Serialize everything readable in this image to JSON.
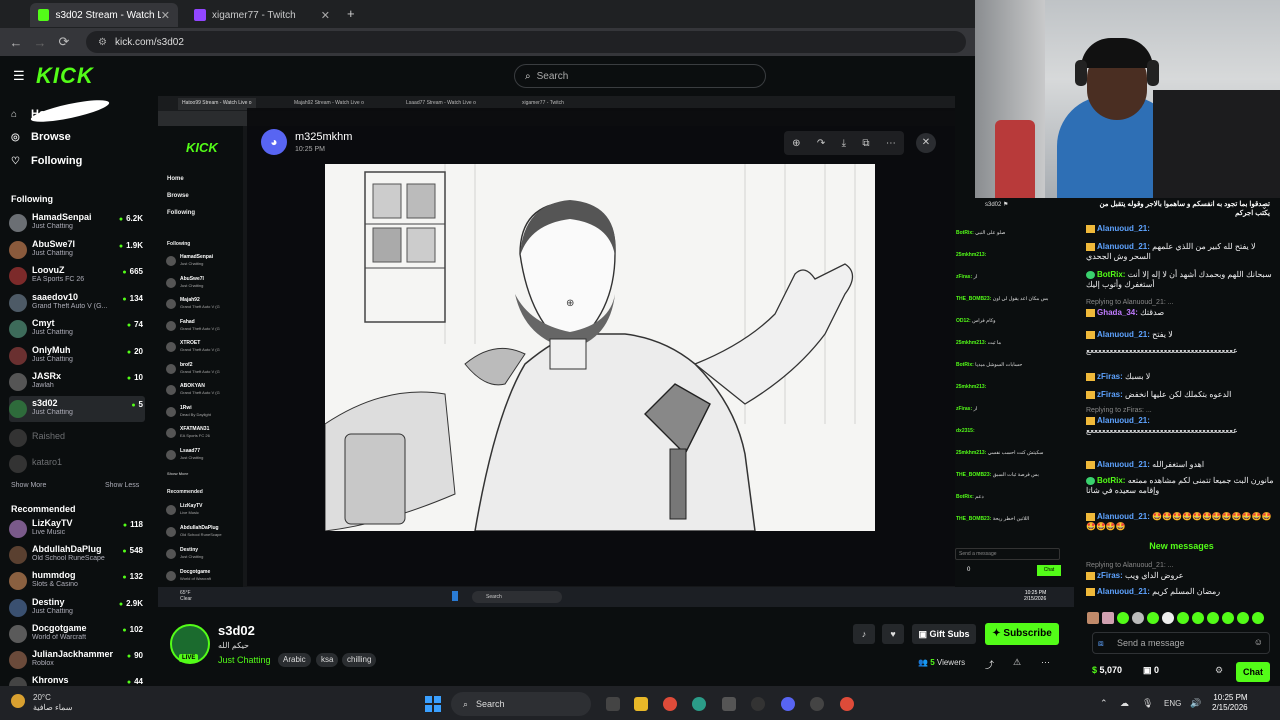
{
  "browser": {
    "tabs": [
      {
        "title": "s3d02 Stream - Watch Live on K",
        "active": true
      },
      {
        "title": "xigamer77 - Twitch",
        "active": false
      }
    ],
    "url": "kick.com/s3d02"
  },
  "kick": {
    "logo": "KICK",
    "search_placeholder": "Search",
    "nav": [
      "Home",
      "Browse",
      "Following"
    ],
    "following_title": "Following",
    "following": [
      {
        "name": "HamadSenpai",
        "category": "Just Chatting",
        "viewers": "6.2K",
        "color": "#6b6f74"
      },
      {
        "name": "AbuSwe7l",
        "category": "Just Chatting",
        "viewers": "1.9K",
        "color": "#8a5a3c"
      },
      {
        "name": "LoovuZ",
        "category": "EA Sports FC 26",
        "viewers": "665",
        "color": "#7c2a2a"
      },
      {
        "name": "saaedov10",
        "category": "Grand Theft Auto V (G...",
        "viewers": "134",
        "color": "#4d5a66"
      },
      {
        "name": "Cmyt",
        "category": "Just Chatting",
        "viewers": "74",
        "color": "#3d6b5a"
      },
      {
        "name": "OnlyMuh",
        "category": "Just Chatting",
        "viewers": "20",
        "color": "#6a3030"
      },
      {
        "name": "JASRx",
        "category": "Jawlah",
        "viewers": "10",
        "color": "#555"
      },
      {
        "name": "s3d02",
        "category": "Just Chatting",
        "viewers": "5",
        "color": "#2e6b3b"
      }
    ],
    "offline": [
      "Raished",
      "kataro1"
    ],
    "show_more": "Show More",
    "show_less": "Show Less",
    "recommended_title": "Recommended",
    "recommended": [
      {
        "name": "LizKayTV",
        "category": "Live Music",
        "viewers": "118",
        "color": "#7a5a8a"
      },
      {
        "name": "AbdullahDaPlug",
        "category": "Old School RuneScape",
        "viewers": "548",
        "color": "#5a4030"
      },
      {
        "name": "hummdog",
        "category": "Slots & Casino",
        "viewers": "132",
        "color": "#8a6040"
      },
      {
        "name": "Destiny",
        "category": "Just Chatting",
        "viewers": "2.9K",
        "color": "#3a5070"
      },
      {
        "name": "Docgotgame",
        "category": "World of Warcraft",
        "viewers": "102",
        "color": "#5a5a5a"
      },
      {
        "name": "JulianJackhammer",
        "category": "Roblox",
        "viewers": "90",
        "color": "#6a4a3a"
      },
      {
        "name": "Khronvs",
        "category": "",
        "viewers": "44",
        "color": "#444"
      }
    ]
  },
  "inner": {
    "tabs": [
      "Hatoo99 Stream - Watch Live o",
      "Majah92 Stream - Watch Live o",
      "Lsaad77 Stream - Watch Live o",
      "xigamer77 - Twitch"
    ],
    "nav": [
      "Home",
      "Browse",
      "Following"
    ],
    "following_title": "Following",
    "channels": [
      {
        "n": "HamadSenpai",
        "c": "Just Chatting"
      },
      {
        "n": "AbuSwe7l",
        "c": "Just Chatting"
      },
      {
        "n": "Majah92",
        "c": "Grand Theft Auto V (G"
      },
      {
        "n": "Fahad",
        "c": "Grand Theft Auto V (G"
      },
      {
        "n": "XTROET",
        "c": "Grand Theft Auto V (G"
      },
      {
        "n": "brof2",
        "c": "Grand Theft Auto V (G"
      },
      {
        "n": "ABOKYAN",
        "c": "Grand Theft Auto V (G"
      },
      {
        "n": "1Rwi",
        "c": "Dead By Daylight"
      },
      {
        "n": "XFATMAN31",
        "c": "EA Sports FC 26"
      },
      {
        "n": "Lsaad77",
        "c": "Just Chatting"
      }
    ],
    "show_more": "Show More",
    "recommended_title": "Recommended",
    "recommended": [
      {
        "n": "LizKayTV",
        "c": "Live Music"
      },
      {
        "n": "AbdullahDaPlug",
        "c": "Old School RuneScape"
      },
      {
        "n": "Destiny",
        "c": "Just Chatting"
      },
      {
        "n": "Docgotgame",
        "c": "World of Warcraft"
      }
    ],
    "weather": "65°F",
    "weather_sub": "Clear",
    "taskbar_search": "Search",
    "clock_time": "10:25 PM",
    "clock_date": "2/15/2026"
  },
  "discord": {
    "user": "m325mkhm",
    "time": "10:25 PM",
    "close": "✕"
  },
  "inner_chat": [
    {
      "u": "BotRix:",
      "t": "صلو على النبي"
    },
    {
      "u": "25mkhm213:",
      "t": ""
    },
    {
      "u": "zFiras:",
      "t": "ار"
    },
    {
      "u": "THE_BOMB23:",
      "t": "بس مكان اعد يقول لي اون"
    },
    {
      "u": "OD12:",
      "t": "وكام فراس"
    },
    {
      "u": "25mkhm213:",
      "t": "ما ثبت"
    },
    {
      "u": "BotRix:",
      "t": "حسابات السوشل ميديا"
    },
    {
      "u": "25mkhm213:",
      "t": ""
    },
    {
      "u": "zFiras:",
      "t": "ار"
    },
    {
      "u": "dx2315:",
      "t": ""
    },
    {
      "u": "25mkhm213:",
      "t": "سكيتش كنت احسب نفسي"
    },
    {
      "u": "THE_BOMB23:",
      "t": "بس فرصة ثبات السبق"
    },
    {
      "u": "BotRix:",
      "t": "دعم"
    },
    {
      "u": "THE_BOMB23:",
      "t": "اللاتين اخطر ريحة"
    }
  ],
  "chat": {
    "pinned": "تصدقوا بما تجود به انفسكم و ساهموا بالاجر وقوله يتقبل من يكتب اجركم",
    "messages": [
      {
        "user": "Alanuoud_21:",
        "cls": "",
        "text": ""
      },
      {
        "user": "Alanuoud_21:",
        "cls": "",
        "text": "لا يفتح لله كبير من اللذي علمهم السحر وش الجحدي"
      },
      {
        "user": "BotRix:",
        "cls": "g",
        "text": "سبحانك اللهم وبحمدك أشهد أن لا إله إلا أنت أستغفرك وأتوب إليك"
      },
      {
        "user": "Ghada_34:",
        "cls": "p",
        "text": "صدقتك",
        "reply": "Replying to Alanuoud_21: ..."
      },
      {
        "user": "Alanuoud_21:",
        "cls": "",
        "text": "لا يفتح"
      },
      {
        "user": "",
        "cls": "",
        "text": "ععععععععععععععععععععععععععععععععععععععع"
      },
      {
        "user": "zFiras:",
        "cls": "",
        "text": "لا بسبك"
      },
      {
        "user": "zFiras:",
        "cls": "",
        "text": "الدعوه بتكملك لكن عليها انخفض",
        "reply": ""
      },
      {
        "user": "Alanuoud_21:",
        "cls": "",
        "text": "ععععععععععععععععععععععععععععععععععععععع",
        "reply": "Replying to zFiras: ..."
      },
      {
        "user": "Alanuoud_21:",
        "cls": "",
        "text": "اهدو استغفرالله"
      },
      {
        "user": "BotRix:",
        "cls": "g",
        "text": "مانورن البث جميعا تتمنى لكم مشاهده ممتعه وإقامه سعيده في شاتا"
      },
      {
        "user": "Alanuoud_21:",
        "cls": "",
        "text": "🤩🤩🤩🤩🤩🤩🤩🤩🤩🤩🤩🤩🤩🤩🤩🤩"
      }
    ],
    "new_messages": "New messages",
    "after": [
      {
        "user": "zFiras:",
        "text": "عروض الداي ويب",
        "reply": "Replying to Alanuoud_21: ..."
      },
      {
        "user": "Alanuoud_21:",
        "text": "رمضان المسلم كريم"
      }
    ],
    "send_placeholder": "Send a message",
    "points": "5,070",
    "subs": "0",
    "chat_button": "Chat"
  },
  "stream": {
    "name": "s3d02",
    "title": "حيكم الله",
    "category": "Just Chatting",
    "tags": [
      "Arabic",
      "ksa",
      "chilling"
    ],
    "gift_subs": "Gift Subs",
    "subscribe": "Subscribe",
    "viewers_count": "5",
    "viewers_label": "Viewers",
    "live": "LIVE"
  },
  "taskbar": {
    "weather_temp": "20°C",
    "weather_text": "سماء صافية",
    "search": "Search",
    "lang": "ENG",
    "time": "10:25 PM",
    "date": "2/15/2026"
  }
}
